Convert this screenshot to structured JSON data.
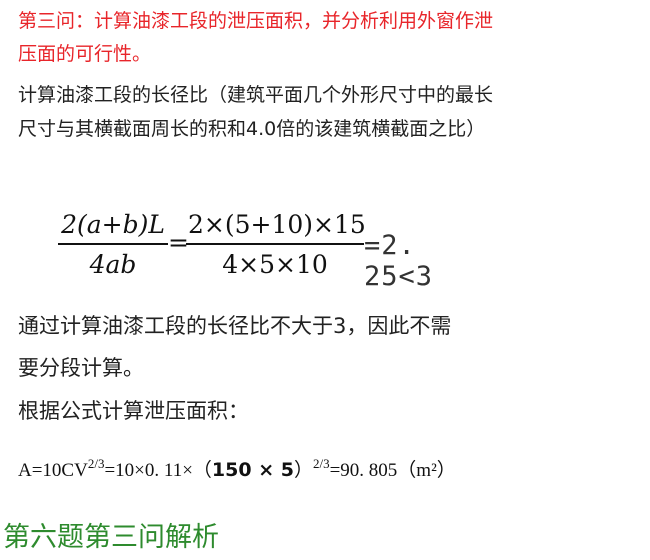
{
  "question": {
    "title_line1": "第三问：计算油漆工段的泄压面积，并分析利用外窗作泄",
    "title_line2": "压面的可行性。"
  },
  "definition": {
    "line1": "计算油漆工段的长径比（建筑平面几个外形尺寸中的最长",
    "line2": "尺寸与其横截面周长的积和4.0倍的该建筑横截面之比）"
  },
  "formula": {
    "frac1_num": "2(a+b)L",
    "frac1_den": "4ab",
    "eq": "=",
    "frac2_num": "2×(5+10)×15",
    "frac2_den": "4×5×10",
    "result": "=2. 25<3"
  },
  "conclusion": {
    "line1": "通过计算油漆工段的长径比不大于3，因此不需",
    "line2": "要分段计算。",
    "line3": "根据公式计算泄压面积："
  },
  "area_formula": {
    "prefix": "A=10CV",
    "exp1": "2/3",
    "middle": "=10×0. 11×（",
    "inner": "150 × 5",
    "close": "）",
    "exp2": "2/3",
    "suffix": "=90. 805（m²）"
  },
  "footer": {
    "label": "第六题第三问解析"
  },
  "colors": {
    "title_red": "#e8252a",
    "footer_green": "#2e8b2e"
  }
}
